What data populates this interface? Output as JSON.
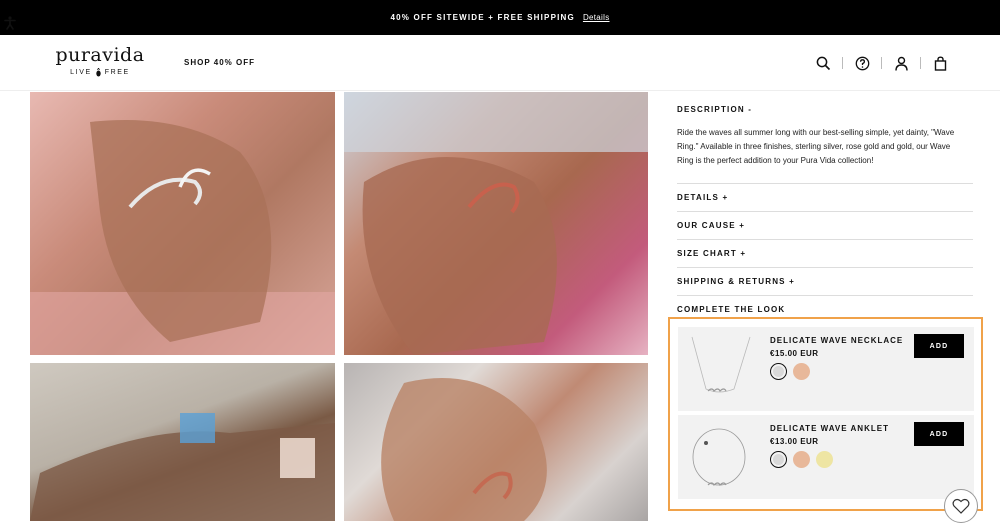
{
  "banner": {
    "text": "40% OFF SITEWIDE + FREE SHIPPING",
    "link": "Details"
  },
  "header": {
    "logo_word": "puravida",
    "logo_tag_left": "LIVE",
    "logo_tag_right": "FREE",
    "nav_shop": "SHOP 40% OFF",
    "icons": [
      "search-icon",
      "help-icon",
      "account-icon",
      "bag-icon"
    ]
  },
  "gallery": [
    {
      "alt": "silver-wave-ring-on-hand"
    },
    {
      "alt": "rose-gold-wave-ring-on-hand"
    },
    {
      "alt": "bracelets-on-wrists"
    },
    {
      "alt": "rose-gold-wave-ring-on-hand-closeup"
    }
  ],
  "details": {
    "description_heading": "DESCRIPTION -",
    "description_text": "Ride the waves all summer long with our best-selling simple, yet dainty, \"Wave Ring.\" Available in three finishes, sterling silver, rose gold and gold, our Wave Ring is the perfect addition to your Pura Vida collection!",
    "sections": [
      "DETAILS +",
      "OUR CAUSE +",
      "SIZE CHART +",
      "SHIPPING & RETURNS +"
    ],
    "complete_heading": "COMPLETE THE LOOK"
  },
  "look": {
    "products": [
      {
        "name": "DELICATE WAVE NECKLACE",
        "price": "€15.00 EUR",
        "add_label": "ADD",
        "swatches": [
          "#d9d9d9",
          "#e8b89a"
        ],
        "selected_swatch": 0
      },
      {
        "name": "DELICATE WAVE ANKLET",
        "price": "€13.00 EUR",
        "add_label": "ADD",
        "swatches": [
          "#d9d9d9",
          "#e8b89a",
          "#eee5a3"
        ],
        "selected_swatch": 0
      }
    ]
  },
  "colors": {
    "banner_bg": "#000000",
    "highlight_border": "#f0a24a",
    "card_bg": "#f2f2f2"
  }
}
